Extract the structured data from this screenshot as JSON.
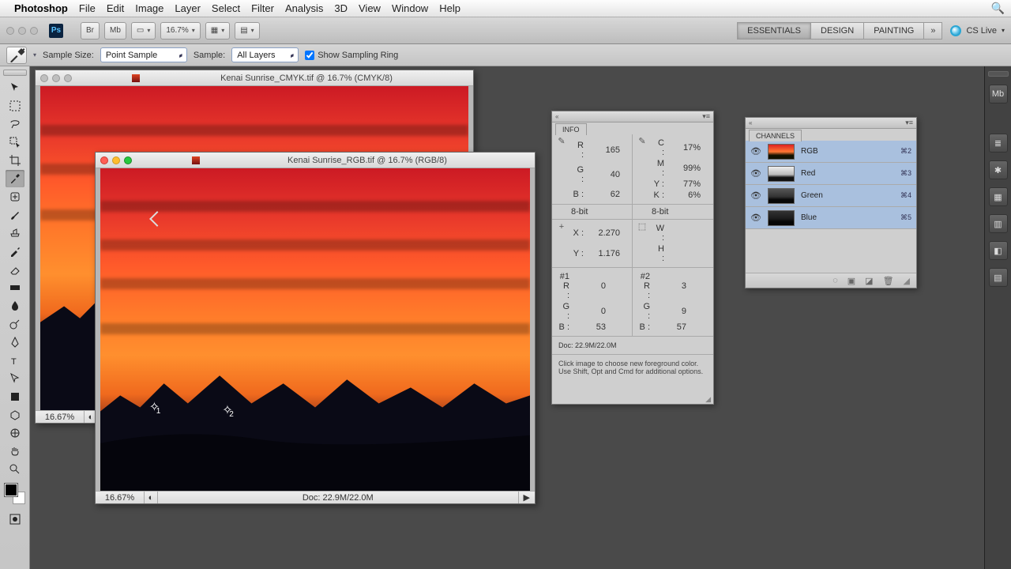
{
  "menubar": {
    "app": "Photoshop",
    "items": [
      "File",
      "Edit",
      "Image",
      "Layer",
      "Select",
      "Filter",
      "Analysis",
      "3D",
      "View",
      "Window",
      "Help"
    ]
  },
  "toolbar": {
    "zoom": "16.7%",
    "workspaces": [
      "ESSENTIALS",
      "DESIGN",
      "PAINTING"
    ],
    "cslive": "CS Live"
  },
  "options": {
    "sample_size_label": "Sample Size:",
    "sample_size_value": "Point Sample",
    "sample_label": "Sample:",
    "sample_value": "All Layers",
    "ring_label": "Show Sampling Ring"
  },
  "doc1": {
    "title": "Kenai Sunrise_CMYK.tif @ 16.7% (CMYK/8)",
    "zoom": "16.67%"
  },
  "doc2": {
    "title": "Kenai Sunrise_RGB.tif @ 16.7% (RGB/8)",
    "zoom": "16.67%",
    "docsize": "Doc: 22.9M/22.0M"
  },
  "info": {
    "tab": "INFO",
    "rgb": {
      "R": "165",
      "G": "40",
      "B": "62"
    },
    "cmyk": {
      "C": "17%",
      "M": "99%",
      "Y": "77%",
      "K": "6%"
    },
    "depth_left": "8-bit",
    "depth_right": "8-bit",
    "xy": {
      "X": "2.270",
      "Y": "1.176"
    },
    "wh": {
      "W": "",
      "H": ""
    },
    "s1": {
      "label1": "#1 R :",
      "v1": "0",
      "label2": "G :",
      "v2": "0",
      "label3": "B :",
      "v3": "53"
    },
    "s2": {
      "label1": "#2 R :",
      "v1": "3",
      "label2": "G :",
      "v2": "9",
      "label3": "B :",
      "v3": "57"
    },
    "docsize": "Doc: 22.9M/22.0M",
    "hint": "Click image to choose new foreground color. Use Shift, Opt and Cmd for additional options."
  },
  "channels": {
    "tab": "CHANNELS",
    "rows": [
      {
        "name": "RGB",
        "key": "⌘2",
        "thumb": "thumb-rgb"
      },
      {
        "name": "Red",
        "key": "⌘3",
        "thumb": "thumb-red"
      },
      {
        "name": "Green",
        "key": "⌘4",
        "thumb": "thumb-green"
      },
      {
        "name": "Blue",
        "key": "⌘5",
        "thumb": "thumb-blue"
      }
    ]
  }
}
